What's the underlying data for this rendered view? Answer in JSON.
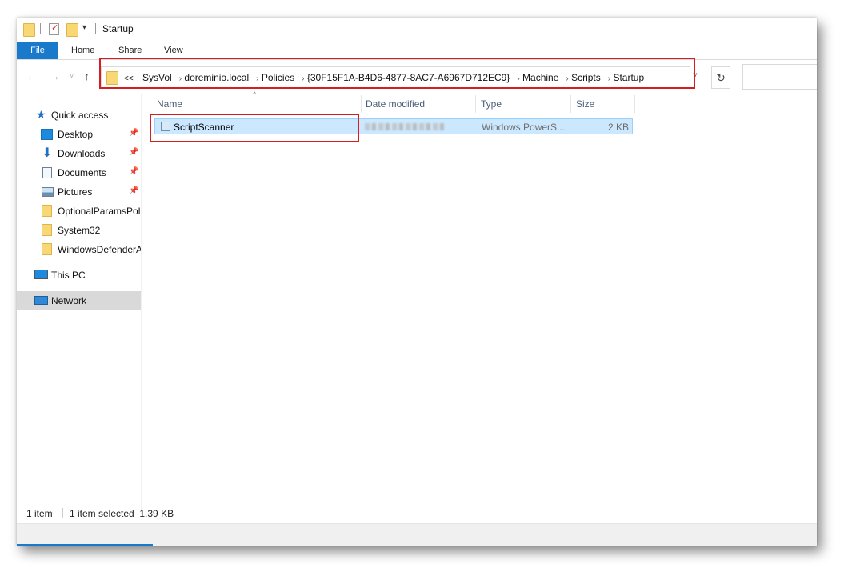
{
  "window": {
    "title": "Startup"
  },
  "ribbon": {
    "tabs": [
      "File",
      "Home",
      "Share",
      "View"
    ]
  },
  "address": {
    "overflow": "<<",
    "crumbs": [
      "SysVol",
      "doreminio.local",
      "Policies",
      "{30F15F1A-B4D6-4877-8AC7-A6967D712EC9}",
      "Machine",
      "Scripts",
      "Startup"
    ]
  },
  "nav_pane": {
    "items": [
      {
        "label": "Quick access",
        "icon": "star-icon",
        "pinned": false
      },
      {
        "label": "Desktop",
        "icon": "desktop-icon",
        "pinned": true
      },
      {
        "label": "Downloads",
        "icon": "download-arrow-icon",
        "pinned": true
      },
      {
        "label": "Documents",
        "icon": "documents-icon",
        "pinned": true
      },
      {
        "label": "Pictures",
        "icon": "pictures-icon",
        "pinned": true
      },
      {
        "label": "OptionalParamsPol",
        "icon": "folder-icon",
        "pinned": false
      },
      {
        "label": "System32",
        "icon": "folder-icon",
        "pinned": false
      },
      {
        "label": "WindowsDefenderA",
        "icon": "folder-icon",
        "pinned": false
      },
      {
        "label": "This PC",
        "icon": "computer-icon",
        "pinned": false
      },
      {
        "label": "Network",
        "icon": "network-icon",
        "pinned": false,
        "selected": true
      }
    ]
  },
  "file_list": {
    "columns": [
      "Name",
      "Date modified",
      "Type",
      "Size"
    ],
    "rows": [
      {
        "name": "ScriptScanner",
        "date_modified": "",
        "type": "Windows PowerS...",
        "size": "2 KB",
        "selected": true
      }
    ]
  },
  "status": {
    "item_count": "1 item",
    "selection": "1 item selected  1.39 KB"
  },
  "colors": {
    "accent": "#1979ca",
    "selection_bg": "#cce8ff",
    "highlight_box": "#d61e1e"
  }
}
